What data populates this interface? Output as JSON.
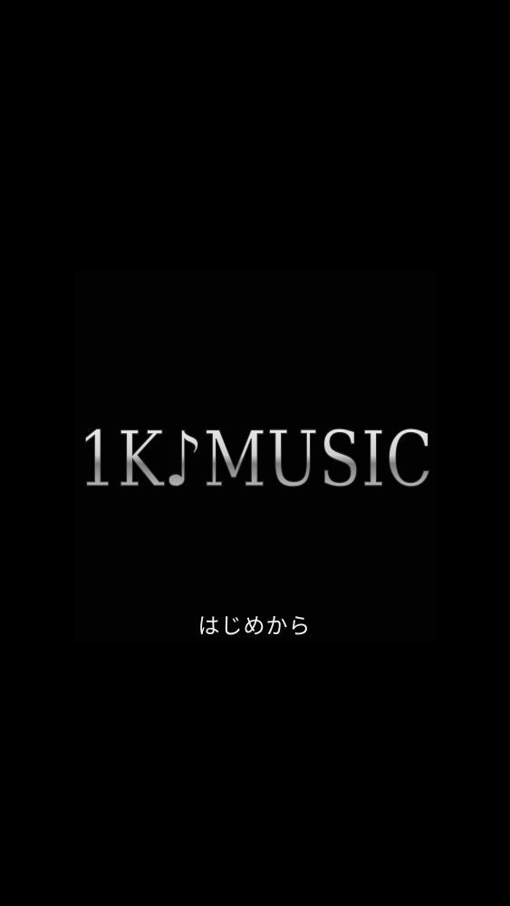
{
  "logo": {
    "text": "1K♪MUSIC"
  },
  "menu": {
    "start_label": "はじめから"
  },
  "colors": {
    "background": "#000000",
    "logo_light": "#f0f0f0",
    "logo_mid": "#9a9a9a",
    "logo_dark": "#2a2a2a",
    "menu_text": "#f2f2f2"
  },
  "icons": {
    "logo_note": "music-note-icon"
  }
}
